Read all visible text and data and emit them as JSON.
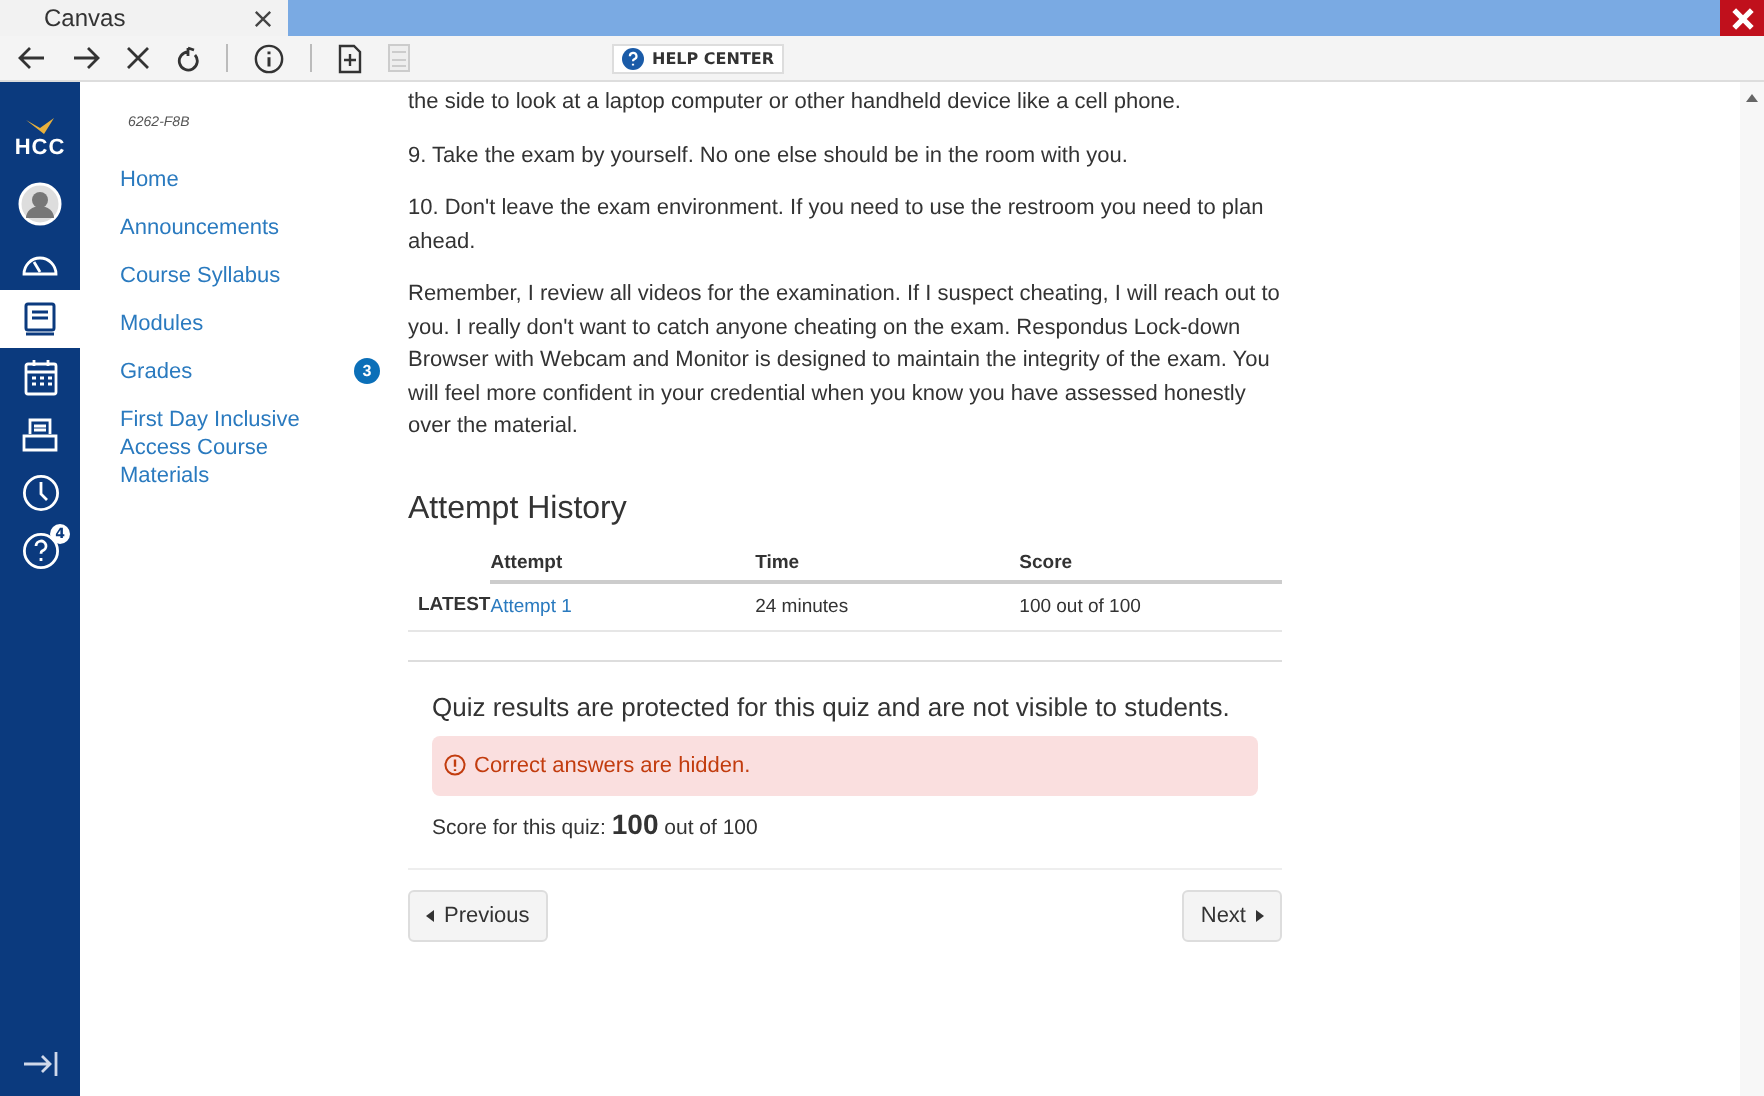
{
  "browser": {
    "tab_title": "Canvas",
    "help_center": "HELP CENTER"
  },
  "global_nav": [
    {
      "kind": "logo",
      "label": "HCC",
      "selected": false
    },
    {
      "kind": "avatar",
      "selected": false
    },
    {
      "kind": "dashboard",
      "selected": false
    },
    {
      "kind": "courses",
      "selected": true
    },
    {
      "kind": "calendar",
      "selected": false
    },
    {
      "kind": "inbox",
      "selected": false
    },
    {
      "kind": "history",
      "selected": false
    },
    {
      "kind": "help",
      "badge": "4",
      "selected": false
    }
  ],
  "course_nav": {
    "code": "6262-F8B",
    "items": [
      {
        "label": "Home"
      },
      {
        "label": "Announcements"
      },
      {
        "label": "Course Syllabus"
      },
      {
        "label": "Modules"
      },
      {
        "label": "Grades",
        "badge": "3"
      },
      {
        "label": "First Day Inclusive Access Course Materials"
      }
    ]
  },
  "paragraphs": [
    "the side to look at a laptop computer or other handheld device like a cell phone.",
    "9. Take the exam by yourself. No one else should be in the room with you.",
    "10. Don't leave the exam environment. If you need to use the restroom you need to plan ahead.",
    "Remember, I review all videos for the examination. If I suspect cheating, I will reach out to you. I really don't want to catch anyone cheating on the exam. Respondus Lock-down Browser with Webcam and Monitor is designed to maintain the integrity of the exam. You will feel more confident in your credential when you know you have assessed honestly over the material."
  ],
  "attempt_history": {
    "title": "Attempt History",
    "columns": [
      "Attempt",
      "Time",
      "Score"
    ],
    "rows": [
      {
        "label": "LATEST",
        "attempt": "Attempt 1",
        "time": "24 minutes",
        "score": "100 out of 100"
      }
    ]
  },
  "notice": "Quiz results are protected for this quiz and are not visible to students.",
  "alert": "Correct answers are hidden.",
  "score_text": "Score for this quiz: **100** out of 100",
  "buttons": {
    "previous": "Previous",
    "next": "Next"
  }
}
